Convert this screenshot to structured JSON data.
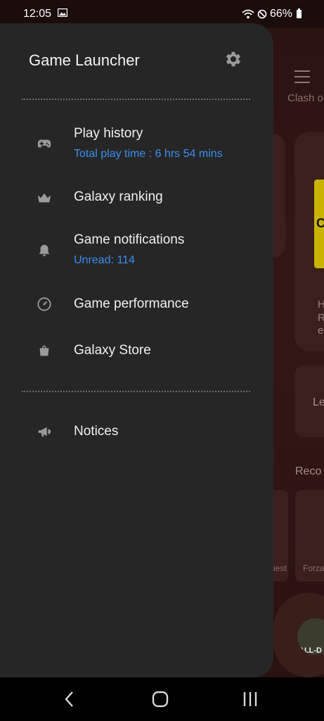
{
  "status_bar": {
    "time": "12:05",
    "battery": "66%"
  },
  "background": {
    "clash_label": "Clash o",
    "left_label": "Le",
    "recommend_label": "Reco",
    "card_text_h": "H",
    "card_text_r": "R",
    "card_text_e": "e",
    "quest_label": "uest",
    "forza_label": "Forza",
    "thumb_letter": "C",
    "avatar_text": "ALL-D"
  },
  "drawer": {
    "title": "Game Launcher",
    "items": [
      {
        "label": "Play history",
        "sub": "Total play time : 6 hrs 54 mins",
        "icon": "gamepad-icon"
      },
      {
        "label": "Galaxy ranking",
        "icon": "crown-icon"
      },
      {
        "label": "Game notifications",
        "sub": "Unread: 114",
        "icon": "bell-icon"
      },
      {
        "label": "Game performance",
        "icon": "speedometer-icon"
      },
      {
        "label": "Galaxy Store",
        "icon": "shopping-bag-icon"
      },
      {
        "label": "Notices",
        "icon": "megaphone-icon"
      }
    ]
  },
  "colors": {
    "drawer_bg": "#262626",
    "accent_blue": "#3a8ef0",
    "background_tint": "#331714"
  }
}
